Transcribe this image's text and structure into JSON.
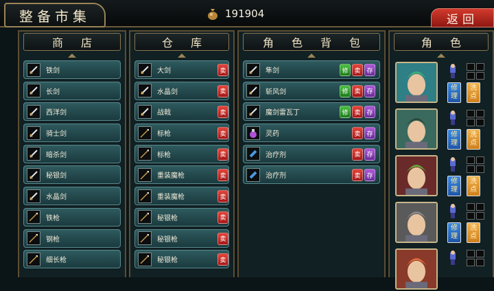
{
  "header": {
    "title": "整备市集",
    "gold": "191904",
    "back_label": "返回"
  },
  "panels": {
    "shop": "商店",
    "warehouse": "仓库",
    "backpack": "角色背包",
    "character": "角色"
  },
  "shop_items": [
    {
      "name": "铁剑",
      "icon": "sword-icon"
    },
    {
      "name": "长剑",
      "icon": "sword-icon"
    },
    {
      "name": "西洋剑",
      "icon": "sword-icon"
    },
    {
      "name": "骑士剑",
      "icon": "sword-icon"
    },
    {
      "name": "暗杀剑",
      "icon": "sword-icon"
    },
    {
      "name": "秘银剑",
      "icon": "sword-icon"
    },
    {
      "name": "水晶剑",
      "icon": "sword-icon"
    },
    {
      "name": "铁枪",
      "icon": "spear-icon"
    },
    {
      "name": "钢枪",
      "icon": "spear-icon"
    },
    {
      "name": "细长枪",
      "icon": "spear-icon"
    }
  ],
  "warehouse_items": [
    {
      "name": "大剑",
      "sell": "卖"
    },
    {
      "name": "水晶剑",
      "sell": "卖"
    },
    {
      "name": "战戟",
      "sell": "卖"
    },
    {
      "name": "标枪",
      "sell": "卖"
    },
    {
      "name": "标枪",
      "sell": "卖"
    },
    {
      "name": "重装魔枪",
      "sell": "卖"
    },
    {
      "name": "重装魔枪",
      "sell": "卖"
    },
    {
      "name": "秘银枪",
      "sell": "卖"
    },
    {
      "name": "秘银枪",
      "sell": "卖"
    },
    {
      "name": "秘银枪",
      "sell": "卖"
    }
  ],
  "backpack_items": [
    {
      "name": "隼剑",
      "fix": "修",
      "sell": "卖",
      "store": "存"
    },
    {
      "name": "斩风剑",
      "fix": "修",
      "sell": "卖",
      "store": "存"
    },
    {
      "name": "魔剑雷瓦丁",
      "fix": "修",
      "sell": "卖",
      "store": "存"
    },
    {
      "name": "灵药",
      "fix": "",
      "sell": "卖",
      "store": "存"
    },
    {
      "name": "治疗剂",
      "fix": "",
      "sell": "卖",
      "store": "存"
    },
    {
      "name": "治疗剂",
      "fix": "",
      "sell": "卖",
      "store": "存"
    }
  ],
  "characters": [
    {
      "fix": "修理",
      "wash": "洗点",
      "hair": "#3fae7a",
      "bg": "#2f7f86"
    },
    {
      "fix": "修理",
      "wash": "洗点",
      "hair": "#2a4a3a",
      "bg": "#3a6a5e"
    },
    {
      "fix": "修理",
      "wash": "洗点",
      "hair": "#6aa83a",
      "bg": "#6a2a2a"
    },
    {
      "fix": "修理",
      "wash": "洗点",
      "hair": "#8a8a8a",
      "bg": "#5a5a5a"
    },
    {
      "fix": "",
      "wash": "",
      "hair": "#e06a3a",
      "bg": "#8a3a2a"
    }
  ]
}
